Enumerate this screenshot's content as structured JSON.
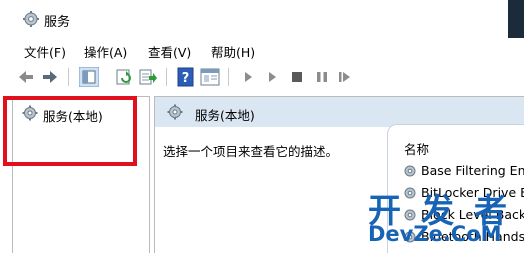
{
  "window": {
    "title": "服务"
  },
  "menu": [
    {
      "label": "文件(F)"
    },
    {
      "label": "操作(A)"
    },
    {
      "label": "查看(V)"
    },
    {
      "label": "帮助(H)"
    }
  ],
  "toolbar": {
    "buttons": [
      {
        "icon": "back-arrow-icon"
      },
      {
        "icon": "forward-arrow-icon"
      },
      {
        "icon": "show-hide-console-tree-icon"
      },
      {
        "icon": "refresh-icon"
      },
      {
        "icon": "export-list-icon"
      },
      {
        "icon": "help-icon"
      },
      {
        "icon": "properties-pane-icon"
      },
      {
        "icon": "start-service-icon"
      },
      {
        "icon": "start-service-alt-icon"
      },
      {
        "icon": "stop-service-icon"
      },
      {
        "icon": "pause-service-icon"
      },
      {
        "icon": "restart-service-icon"
      }
    ]
  },
  "tree": {
    "items": [
      {
        "label": "服务(本地)",
        "icon": "services-gear-icon"
      }
    ]
  },
  "right_pane": {
    "header": "服务(本地)",
    "description": "选择一个项目来查看它的描述。",
    "column_name": "名称",
    "services": [
      {
        "name": "Base Filtering Engine"
      },
      {
        "name": "BitLocker Drive Encryption Service"
      },
      {
        "name": "Block Level Backup Engine Service"
      },
      {
        "name": "Bluetooth Handsfree Service"
      }
    ]
  },
  "watermark": {
    "cn": "开发者",
    "en": "DevZe.CoM"
  },
  "colors": {
    "highlight_box": "#e0101c",
    "pane_header": "#dbe6f3",
    "watermark": "#1763b5"
  }
}
